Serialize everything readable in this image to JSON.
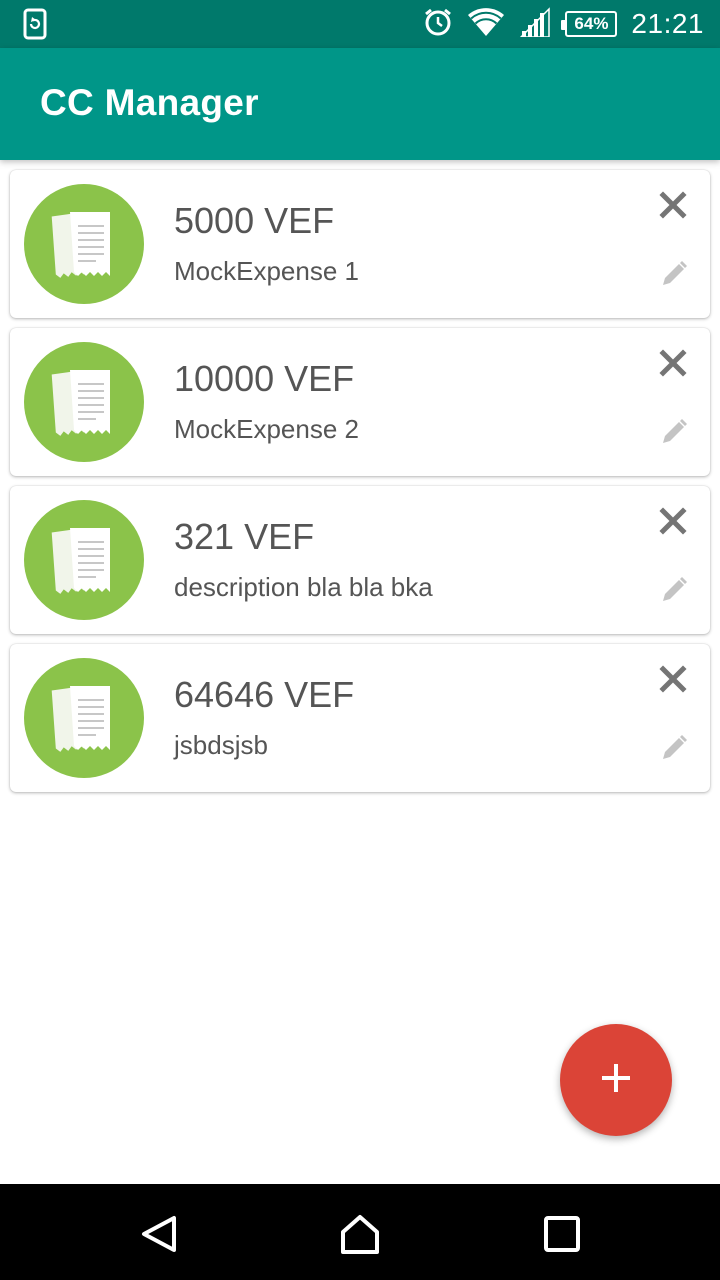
{
  "status_bar": {
    "time": "21:21",
    "battery": "64%",
    "icons": [
      "sync-icon",
      "alarm-icon",
      "wifi-icon",
      "cell-signal-icon",
      "battery-icon"
    ]
  },
  "app_bar": {
    "title": "CC Manager",
    "color": "#009688"
  },
  "expenses": [
    {
      "amount": "5000 VEF",
      "description": "MockExpense 1"
    },
    {
      "amount": "10000 VEF",
      "description": "MockExpense 2"
    },
    {
      "amount": "321 VEF",
      "description": "description bla bla bka"
    },
    {
      "amount": "64646 VEF",
      "description": "jsbdsjsb"
    }
  ],
  "item_icon": "receipt-icon",
  "item_icon_color": "#8bc34a",
  "fab": {
    "icon": "plus-icon",
    "color": "#db4437"
  },
  "nav_bar": {
    "icons": [
      "back-icon",
      "home-icon",
      "recents-icon"
    ]
  }
}
